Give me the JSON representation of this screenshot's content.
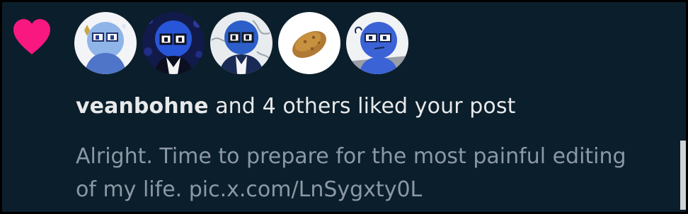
{
  "notification": {
    "type_icon": "heart-icon",
    "heart_color": "#f91880",
    "avatars": [
      {
        "name": "avatar-1"
      },
      {
        "name": "avatar-2"
      },
      {
        "name": "avatar-3"
      },
      {
        "name": "avatar-4"
      },
      {
        "name": "avatar-5"
      }
    ],
    "username": "veanbohne",
    "action_text": " and 4 others liked your post",
    "preview_line1": "Alright. Time to prepare for the most painful editing",
    "preview_line2": "of my life. pic.x.com/LnSygxty0L"
  },
  "colors": {
    "background": "#0b1e2b",
    "primary_text": "#e7e9ea",
    "secondary_text": "#8b98a5",
    "accent_heart": "#f91880"
  }
}
